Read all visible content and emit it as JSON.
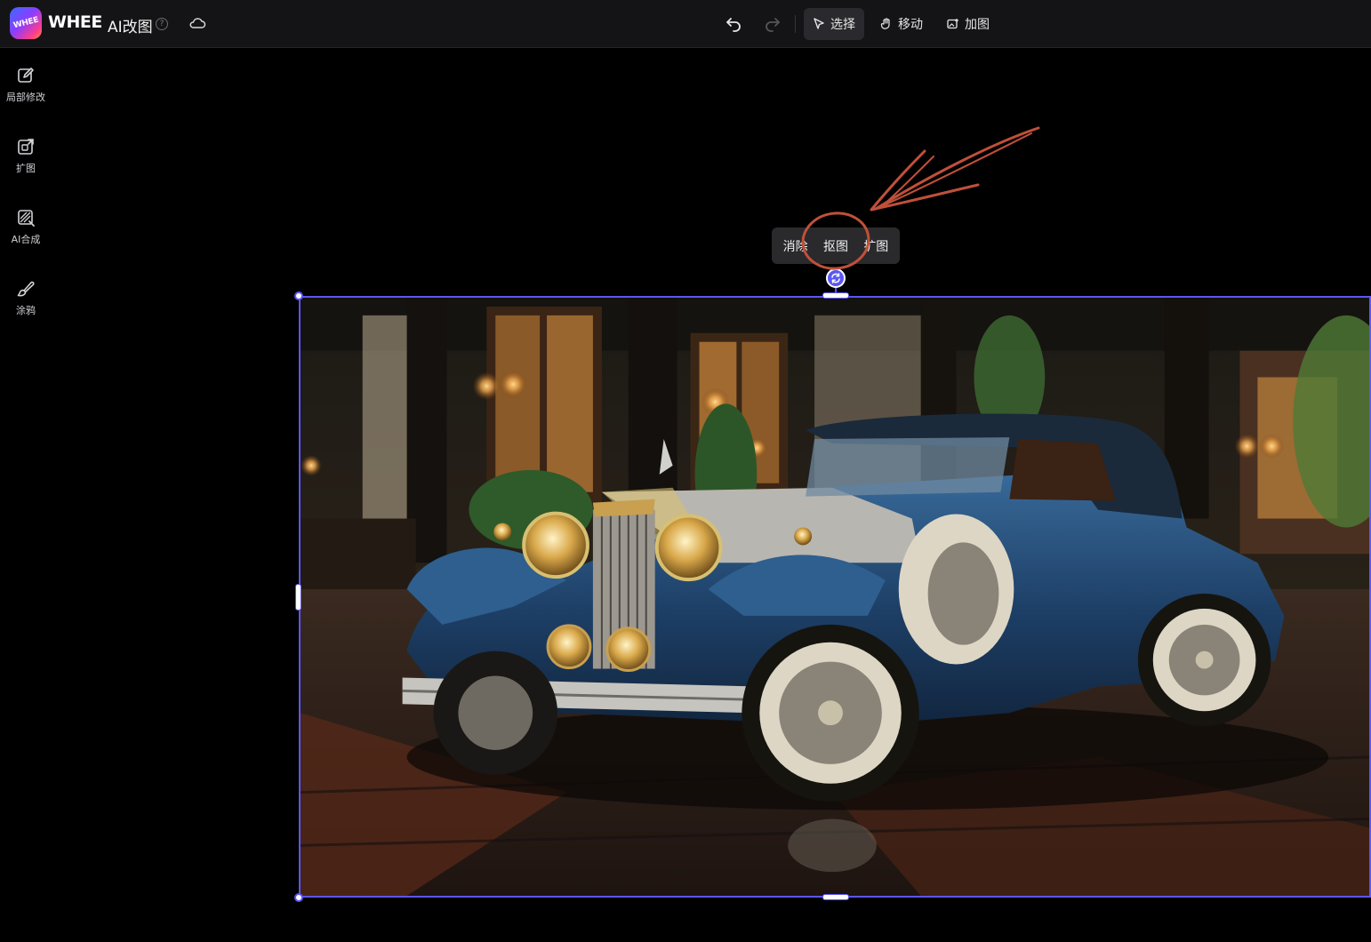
{
  "app": {
    "logo_text": "WHEE",
    "brand": "WHEE",
    "product": "AI改图",
    "help_icon": "?"
  },
  "toolbar": {
    "select": "选择",
    "move": "移动",
    "add_image": "加图"
  },
  "sidebar": {
    "items": [
      {
        "label": "局部修改",
        "icon": "edit-icon"
      },
      {
        "label": "扩图",
        "icon": "expand-icon"
      },
      {
        "label": "AI合成",
        "icon": "ai-compose-icon"
      },
      {
        "label": "涂鸦",
        "icon": "brush-icon"
      }
    ]
  },
  "context_menu": {
    "items": [
      "消除",
      "抠图",
      "扩图"
    ]
  },
  "colors": {
    "accent": "#5b57f5",
    "annotation": "#c0503a",
    "topbar_bg": "#141416",
    "canvas_bg": "#000000"
  },
  "canvas": {
    "image_subject": "vintage blue convertible car on wet tiled plaza"
  }
}
